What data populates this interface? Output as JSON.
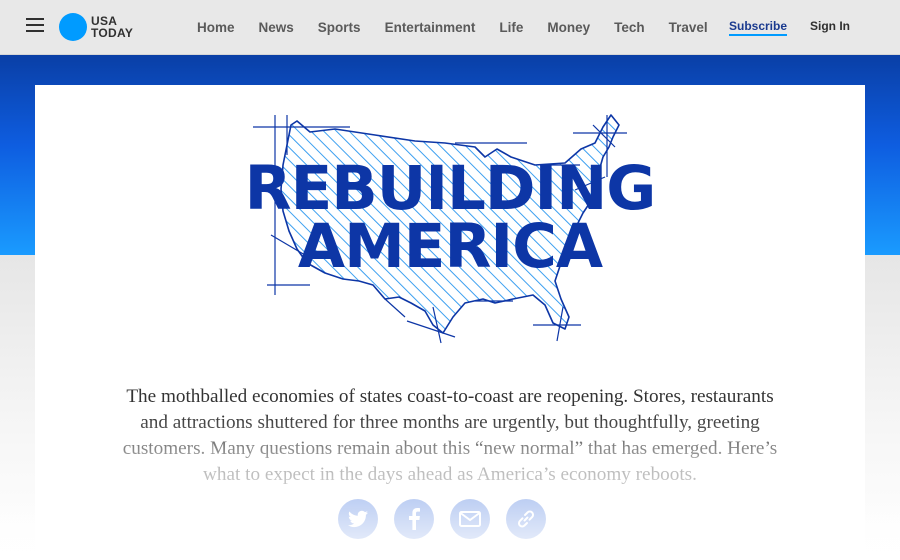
{
  "header": {
    "logo_line1": "USA",
    "logo_line2": "TODAY",
    "nav": [
      "Home",
      "News",
      "Sports",
      "Entertainment",
      "Life",
      "Money",
      "Tech",
      "Travel"
    ],
    "subscribe_label": "Subscribe",
    "signin_label": "Sign In"
  },
  "hero": {
    "headline_line1": "REBUILDING",
    "headline_line2": "AMERICA",
    "intro": "The mothballed economies of states coast-to-coast are reopening. Stores, restaurants and attractions shuttered for three months are urgently, but thoughtfully, greeting customers. Many questions remain about this “new normal” that has emerged. Here’s what to expect in the days ahead as America’s economy reboots."
  },
  "share": [
    "twitter-icon",
    "facebook-icon",
    "email-icon",
    "link-icon"
  ],
  "colors": {
    "brand_blue": "#0d36a6",
    "logo_blue": "#009bff",
    "band_top": "#0a3fa6",
    "band_bottom": "#1a9bff"
  }
}
